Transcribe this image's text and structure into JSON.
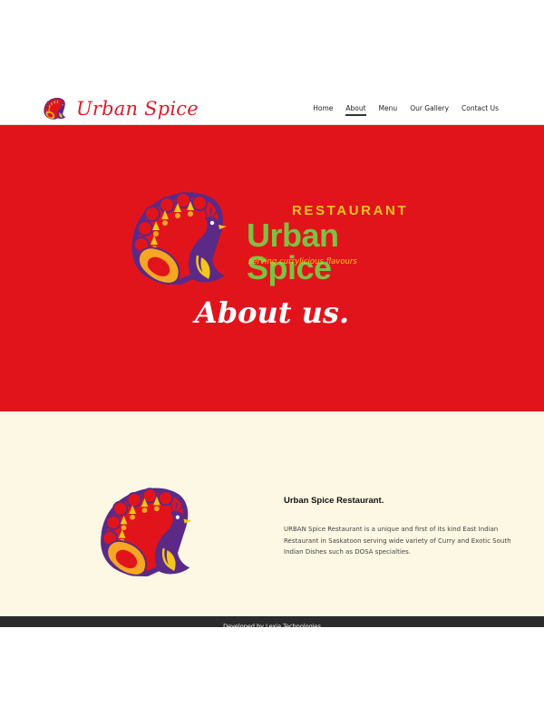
{
  "header": {
    "brand_name": "Urban Spice",
    "brand_icon": "peacock-logo-icon",
    "nav": [
      {
        "label": "Home",
        "active": false
      },
      {
        "label": "About",
        "active": true
      },
      {
        "label": "Menu",
        "active": false
      },
      {
        "label": "Our Gallery",
        "active": false
      },
      {
        "label": "Contact Us",
        "active": false
      }
    ]
  },
  "hero": {
    "logo_restaurant": "RESTAURANT",
    "logo_title": "Urban Spice",
    "logo_tagline": "serving currylicious flavours",
    "heading": "About us."
  },
  "content": {
    "title": "Urban Spice Restaurant.",
    "body": "URBAN Spice Restaurant is a unique and first of its kind East Indian Restaurant in Saskatoon serving wide variety of Curry and Exotic South Indian Dishes such as DOSA specialties."
  },
  "footer": {
    "text": "Developed by Lexia Technologies"
  },
  "colors": {
    "brand_red": "#e1141c",
    "logo_green": "#7cc242",
    "logo_yellow": "#f3c61b",
    "peacock_purple": "#5b2a86",
    "cream_background": "#fcf8e3",
    "footer_dark": "#2b2b2b"
  }
}
